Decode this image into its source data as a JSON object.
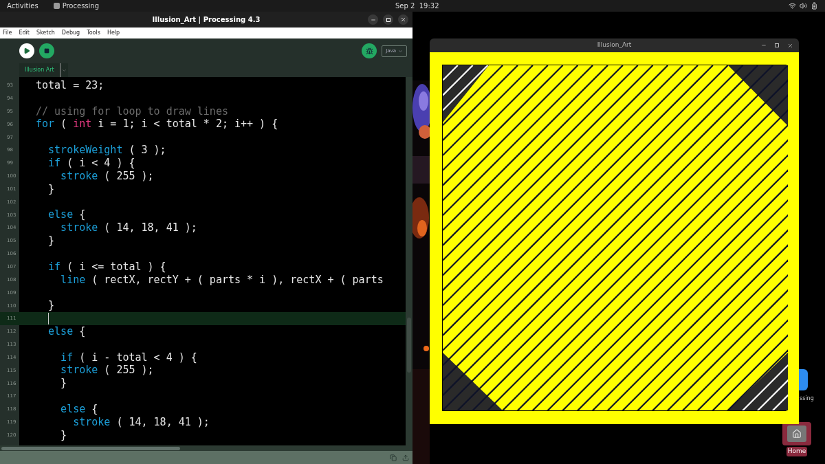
{
  "top_bar": {
    "activities": "Activities",
    "app": "Processing",
    "clock": "Sep 2  19:32"
  },
  "ide": {
    "title": "Illusion_Art | Processing 4.3",
    "menu": [
      "File",
      "Edit",
      "Sketch",
      "Debug",
      "Tools",
      "Help"
    ],
    "mode": "Java",
    "tabs": [
      {
        "label": "Illusion Art",
        "selected": true
      }
    ],
    "lines": [
      {
        "number": "93",
        "current": false,
        "tokens": [
          {
            "text": "total = 23;",
            "kind": "plain"
          }
        ]
      },
      {
        "number": "94",
        "current": false
      },
      {
        "number": "95",
        "current": false,
        "tokens": [
          {
            "text": "// using for loop to draw lines",
            "kind": "comment"
          }
        ]
      },
      {
        "number": "96",
        "current": false,
        "tokens": [
          {
            "text": "for",
            "kind": "keyword"
          },
          {
            "text": " ( ",
            "kind": "plain"
          },
          {
            "text": "int",
            "kind": "type"
          },
          {
            "text": " i = 1; i < total * 2; i++ ) {",
            "kind": "plain"
          }
        ]
      },
      {
        "number": "97",
        "current": false
      },
      {
        "number": "98",
        "current": false,
        "tokens": [
          {
            "text": "  strokeWeight",
            "kind": "function"
          },
          {
            "text": " ( 3 );",
            "kind": "plain"
          }
        ]
      },
      {
        "number": "99",
        "current": false,
        "tokens": [
          {
            "text": "  if",
            "kind": "keyword"
          },
          {
            "text": " ( i < 4 ) {",
            "kind": "plain"
          }
        ]
      },
      {
        "number": "100",
        "current": false,
        "tokens": [
          {
            "text": "    stroke",
            "kind": "function"
          },
          {
            "text": " ( 255 );",
            "kind": "plain"
          }
        ]
      },
      {
        "number": "101",
        "current": false,
        "tokens": [
          {
            "text": "  }",
            "kind": "plain"
          }
        ]
      },
      {
        "number": "102",
        "current": false
      },
      {
        "number": "103",
        "current": false,
        "tokens": [
          {
            "text": "  else",
            "kind": "keyword"
          },
          {
            "text": " {",
            "kind": "plain"
          }
        ]
      },
      {
        "number": "104",
        "current": false,
        "tokens": [
          {
            "text": "    stroke",
            "kind": "function"
          },
          {
            "text": " ( 14, 18, 41 );",
            "kind": "plain"
          }
        ]
      },
      {
        "number": "105",
        "current": false,
        "tokens": [
          {
            "text": "  }",
            "kind": "plain"
          }
        ]
      },
      {
        "number": "106",
        "current": false
      },
      {
        "number": "107",
        "current": false,
        "tokens": [
          {
            "text": "  if",
            "kind": "keyword"
          },
          {
            "text": " ( i <= total ) {",
            "kind": "plain"
          }
        ]
      },
      {
        "number": "108",
        "current": false,
        "tokens": [
          {
            "text": "    line",
            "kind": "function"
          },
          {
            "text": " ( rectX, rectY + ( parts * i ), rectX + ( parts",
            "kind": "plain"
          }
        ]
      },
      {
        "number": "109",
        "current": false
      },
      {
        "number": "110",
        "current": false,
        "tokens": [
          {
            "text": "  }",
            "kind": "plain"
          }
        ]
      },
      {
        "number": "111",
        "current": true
      },
      {
        "number": "112",
        "current": false,
        "tokens": [
          {
            "text": "  else",
            "kind": "keyword"
          },
          {
            "text": " {",
            "kind": "plain"
          }
        ]
      },
      {
        "number": "113",
        "current": false
      },
      {
        "number": "114",
        "current": false,
        "tokens": [
          {
            "text": "    if",
            "kind": "keyword"
          },
          {
            "text": " ( i - total < 4 ) {",
            "kind": "plain"
          }
        ]
      },
      {
        "number": "115",
        "current": false,
        "tokens": [
          {
            "text": "    stroke",
            "kind": "function"
          },
          {
            "text": " ( 255 );",
            "kind": "plain"
          }
        ]
      },
      {
        "number": "116",
        "current": false,
        "tokens": [
          {
            "text": "    }",
            "kind": "plain"
          }
        ]
      },
      {
        "number": "117",
        "current": false
      },
      {
        "number": "118",
        "current": false,
        "tokens": [
          {
            "text": "    else",
            "kind": "keyword"
          },
          {
            "text": " {",
            "kind": "plain"
          }
        ]
      },
      {
        "number": "119",
        "current": false,
        "tokens": [
          {
            "text": "      stroke",
            "kind": "function"
          },
          {
            "text": " ( 14, 18, 41 );",
            "kind": "plain"
          }
        ]
      },
      {
        "number": "120",
        "current": false,
        "tokens": [
          {
            "text": "    }",
            "kind": "plain"
          }
        ]
      }
    ]
  },
  "sketch_window": {
    "title": "Illusion_Art"
  },
  "desktop_icons": [
    {
      "label": "ssing"
    },
    {
      "label": "Home"
    }
  ]
}
